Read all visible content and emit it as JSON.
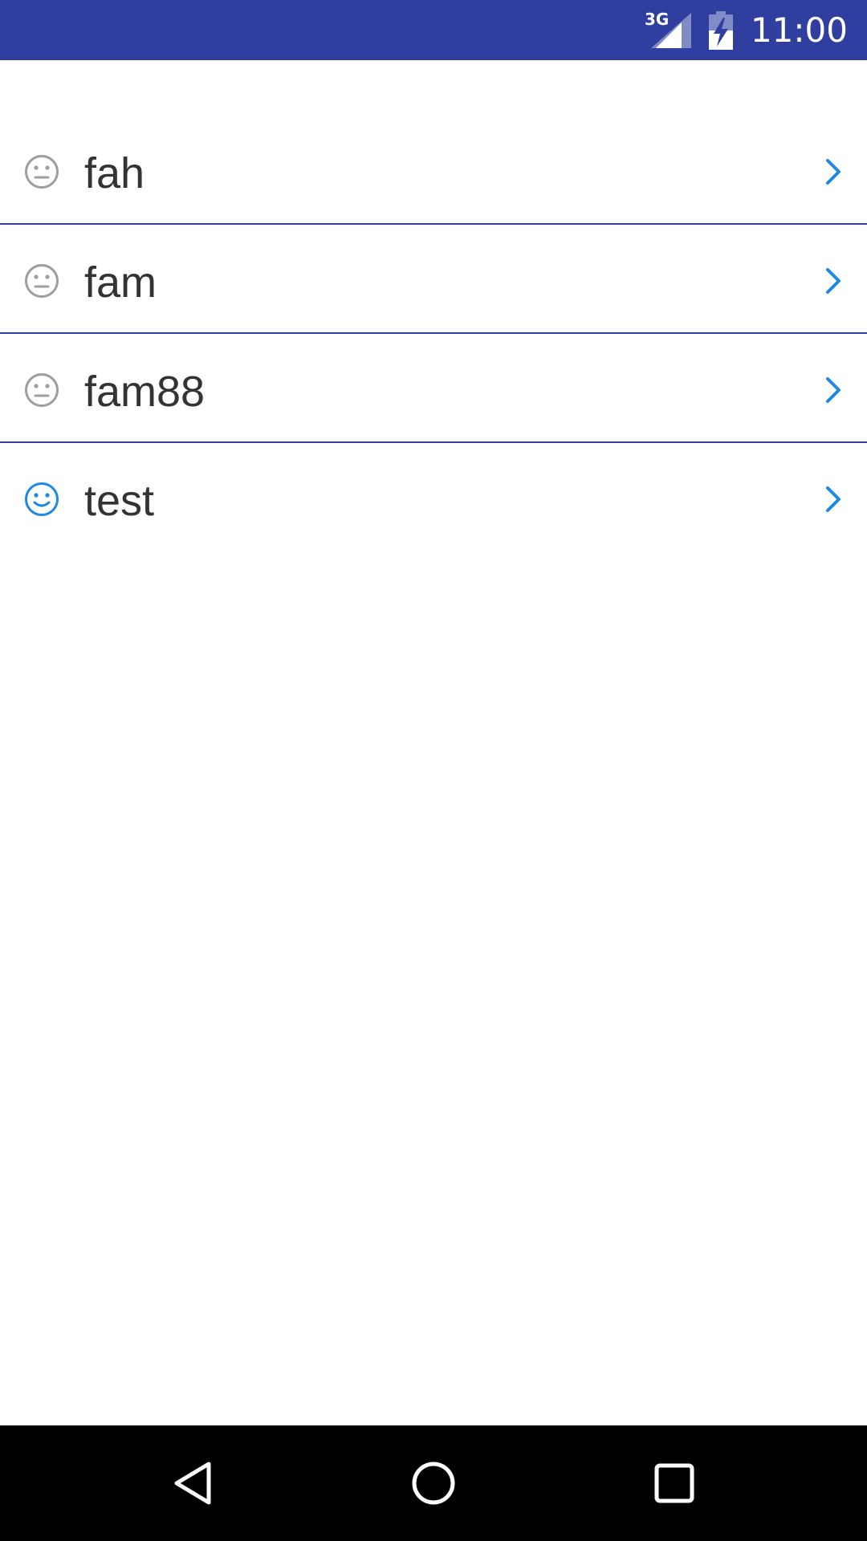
{
  "status_bar": {
    "network_type": "3G",
    "time": "11:00",
    "icons": [
      "signal-icon",
      "battery-charging-icon"
    ]
  },
  "list": {
    "items": [
      {
        "label": "fah",
        "icon": "neutral-face-icon"
      },
      {
        "label": "fam",
        "icon": "neutral-face-icon"
      },
      {
        "label": "fam88",
        "icon": "neutral-face-icon"
      },
      {
        "label": "test",
        "icon": "happy-face-icon"
      }
    ]
  },
  "nav_bar": {
    "icons": [
      "back-icon",
      "home-icon",
      "recents-icon"
    ]
  },
  "colors": {
    "primary_dark": "#303f9f",
    "accent_blue": "#1e88e5",
    "neutral_icon": "#9e9e9e",
    "text": "#333333"
  }
}
